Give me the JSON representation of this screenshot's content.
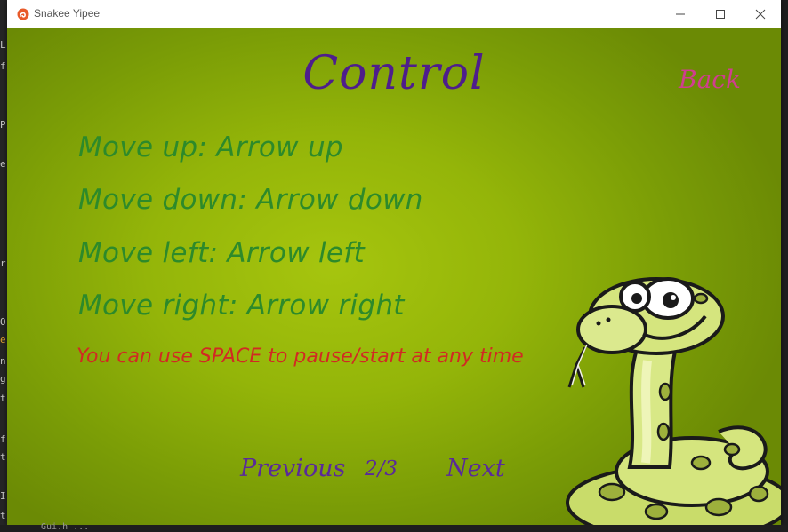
{
  "window": {
    "title": "Snakee Yipee",
    "minimize_icon": "minimize-icon",
    "maximize_icon": "maximize-icon",
    "close_icon": "close-icon"
  },
  "screen": {
    "title": "Control",
    "back_label": "Back",
    "controls": [
      "Move up: Arrow up",
      "Move down: Arrow down",
      "Move left: Arrow left",
      "Move right: Arrow right"
    ],
    "tip": "You can use SPACE to pause/start at any time"
  },
  "pagination": {
    "previous_label": "Previous",
    "page_indicator": "2/3",
    "next_label": "Next"
  },
  "colors": {
    "title": "#4e1e8c",
    "back": "#d03e8e",
    "controls": "#2d8a2a",
    "tip": "#d12a23",
    "nav": "#5a2a9a",
    "background": "#94b509"
  },
  "background_editor": {
    "bottom_text": "Gui.h ..."
  }
}
